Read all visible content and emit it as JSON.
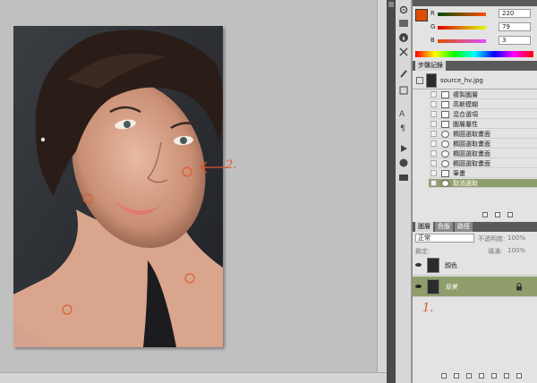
{
  "color_panel": {
    "r_label": "R",
    "r_value": "220",
    "g_label": "G",
    "g_value": "79",
    "b_label": "B",
    "b_value": "3",
    "fg_color": "#dc4f03",
    "bg_color": "#e0a040"
  },
  "history_panel": {
    "tab_label": "步驟記錄",
    "snapshot_name": "source_hv.jpg",
    "steps": [
      {
        "label": "複製圖層",
        "icon": "doc-icon"
      },
      {
        "label": "高斯模糊",
        "icon": "doc-icon"
      },
      {
        "label": "混合選項",
        "icon": "doc-icon"
      },
      {
        "label": "圖層屬性",
        "icon": "doc-icon"
      },
      {
        "label": "橢圓選取畫面",
        "icon": "ellipse-icon"
      },
      {
        "label": "橢圓選取畫面",
        "icon": "ellipse-icon"
      },
      {
        "label": "橢圓選取畫面",
        "icon": "ellipse-icon"
      },
      {
        "label": "橢圓選取畫面",
        "icon": "ellipse-icon"
      },
      {
        "label": "筆畫",
        "icon": "doc-icon"
      },
      {
        "label": "取消選取",
        "icon": "ellipse-icon",
        "selected": true
      }
    ]
  },
  "layers_panel": {
    "tabs": [
      "圖層",
      "色版",
      "路徑"
    ],
    "blend_mode": "正常",
    "opacity_label": "不透明度:",
    "opacity_value": "100%",
    "lock_label": "鎖定:",
    "fill_label": "填滿:",
    "fill_value": "100%",
    "layers": [
      {
        "name": "顏色",
        "selected": false
      },
      {
        "name": "背景",
        "selected": true
      }
    ]
  },
  "annotations": {
    "arrow_label": "2.",
    "layer_note": "1."
  },
  "colors": {
    "selection_green": "#8f9e6a",
    "annotation_orange": "#e0532a"
  }
}
